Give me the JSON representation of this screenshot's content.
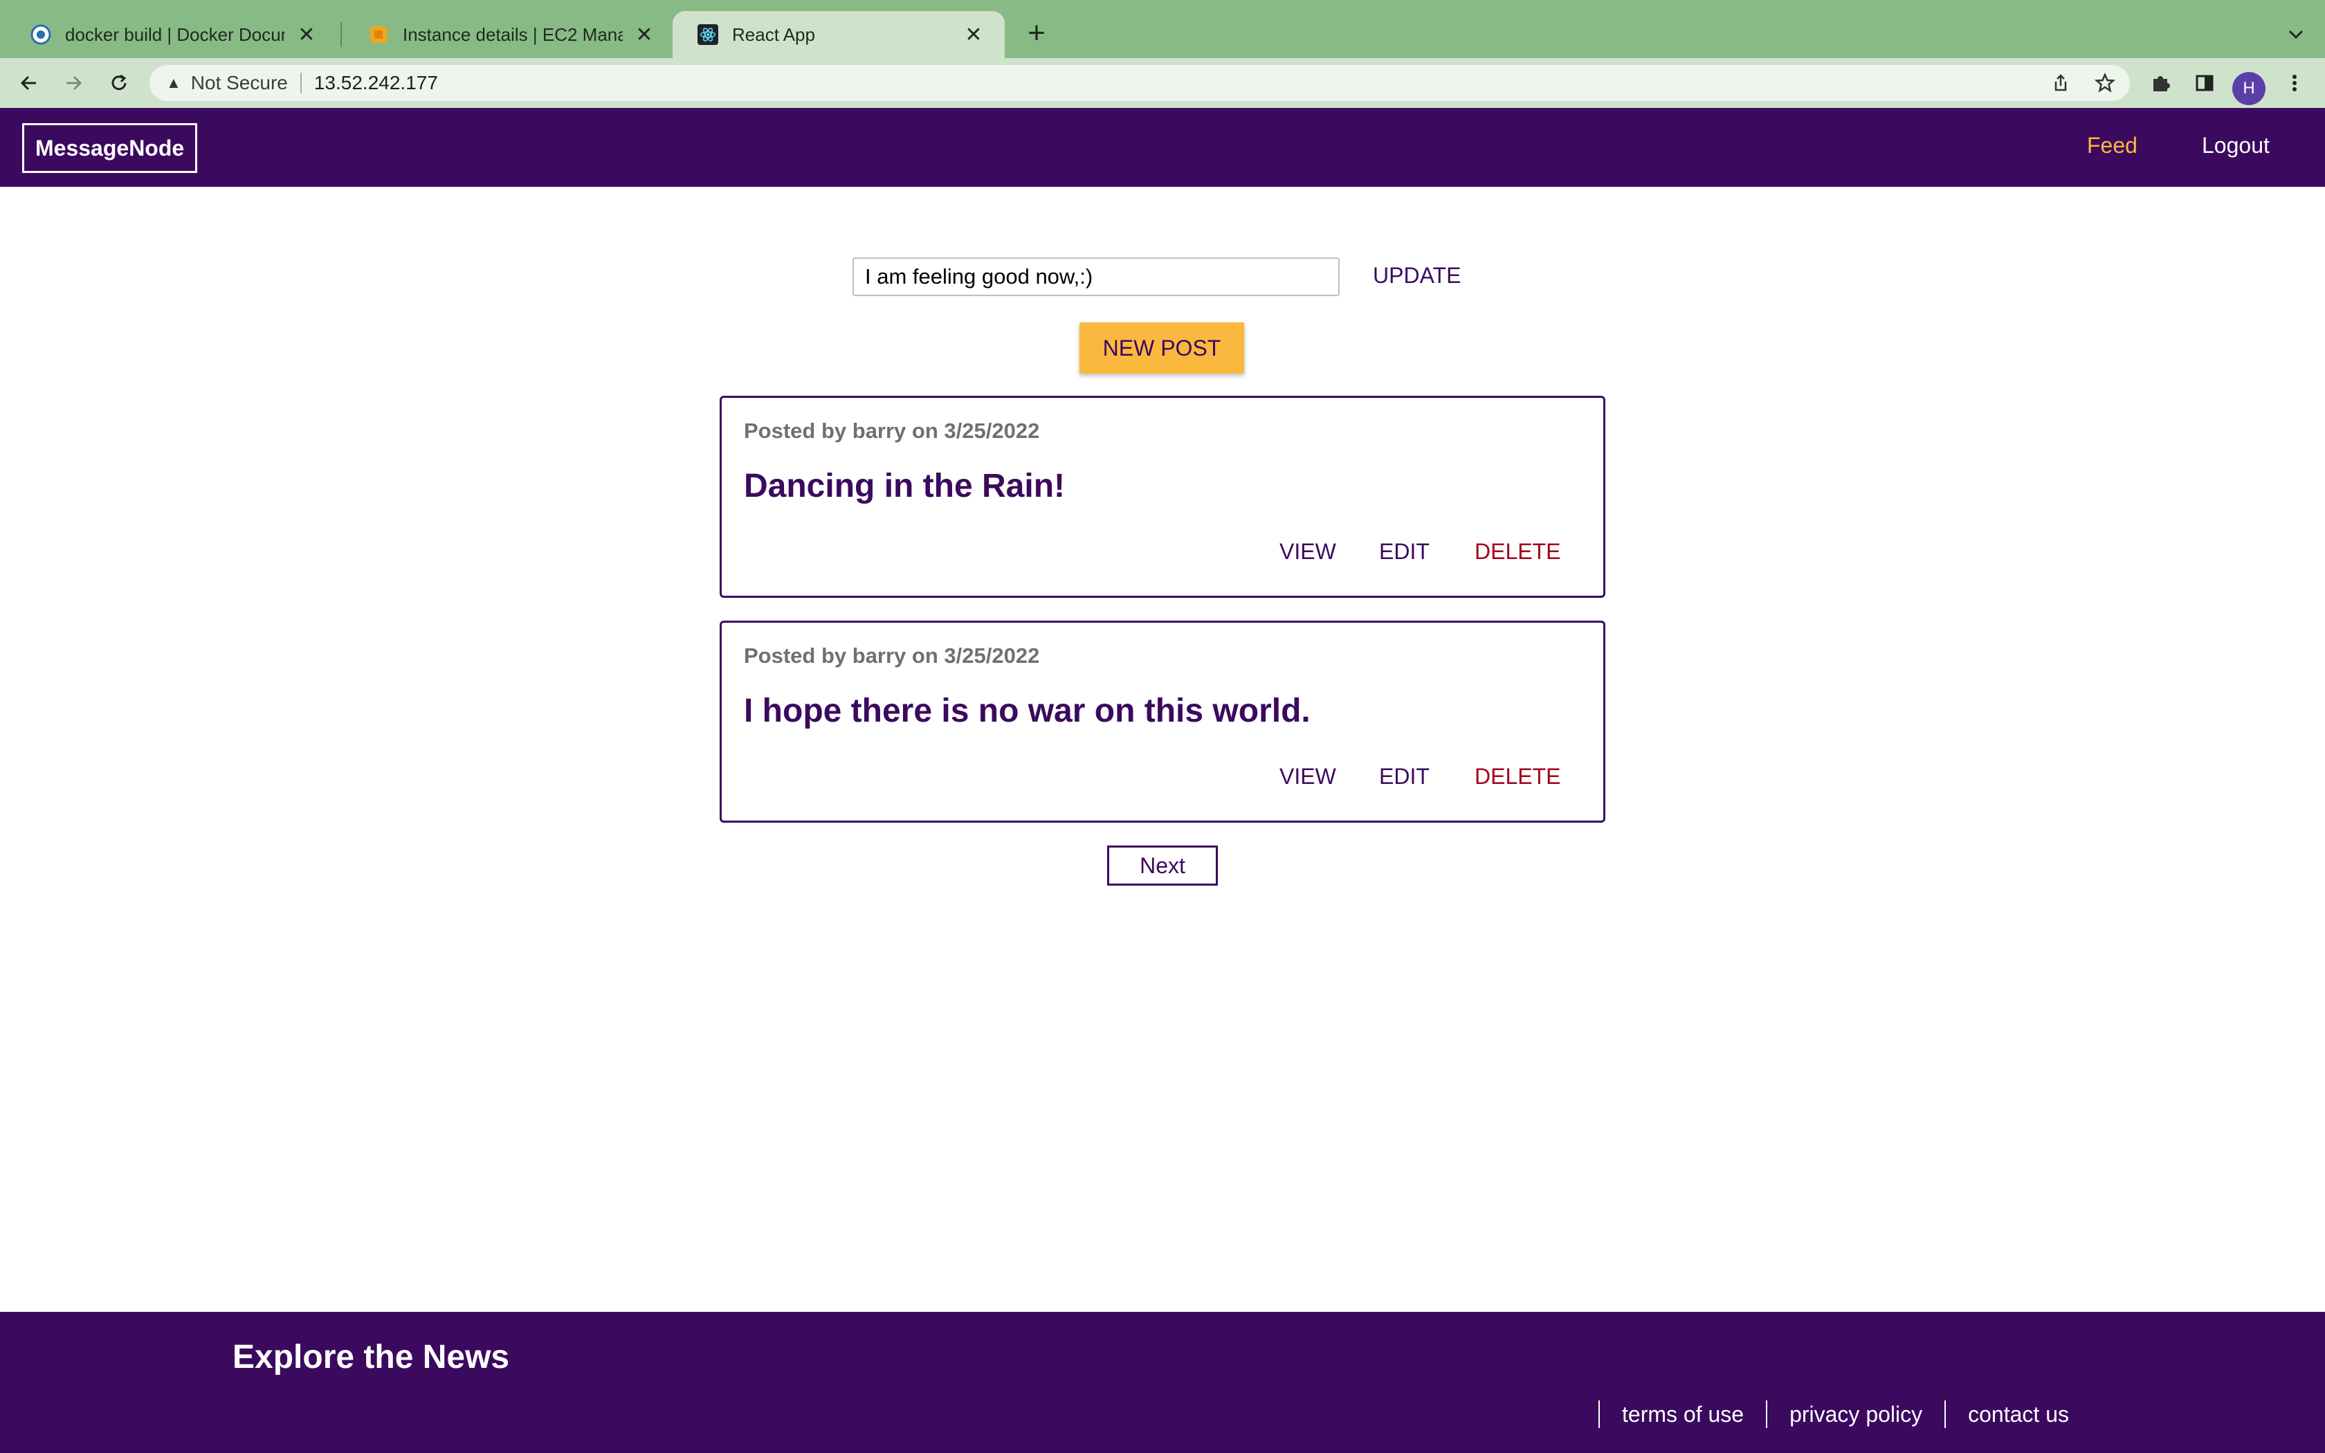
{
  "browser": {
    "tabs": [
      {
        "title": "docker build | Docker Documer",
        "icon": "docker-docs-favicon"
      },
      {
        "title": "Instance details | EC2 Managem",
        "icon": "aws-ec2-favicon"
      },
      {
        "title": "React App",
        "icon": "react-favicon",
        "active": true
      }
    ],
    "security_label": "Not Secure",
    "url": "13.52.242.177",
    "profile_initial": "H"
  },
  "app": {
    "logo": "MessageNode",
    "nav": {
      "feed": "Feed",
      "logout": "Logout"
    },
    "accent_color": "#3b0a5e",
    "highlight_color": "#fab83f"
  },
  "status": {
    "value": "I am feeling good now,:)",
    "update_label": "UPDATE"
  },
  "new_post_label": "NEW POST",
  "posts": [
    {
      "meta": "Posted by barry on 3/25/2022",
      "title": "Dancing in the Rain!",
      "actions": {
        "view": "VIEW",
        "edit": "EDIT",
        "delete": "DELETE"
      }
    },
    {
      "meta": "Posted by barry on 3/25/2022",
      "title": "I hope there is no war on this world.",
      "actions": {
        "view": "VIEW",
        "edit": "EDIT",
        "delete": "DELETE"
      }
    }
  ],
  "pagination": {
    "next_label": "Next"
  },
  "footer": {
    "title": "Explore the News",
    "links": [
      "terms of use",
      "privacy policy",
      "contact us"
    ]
  }
}
